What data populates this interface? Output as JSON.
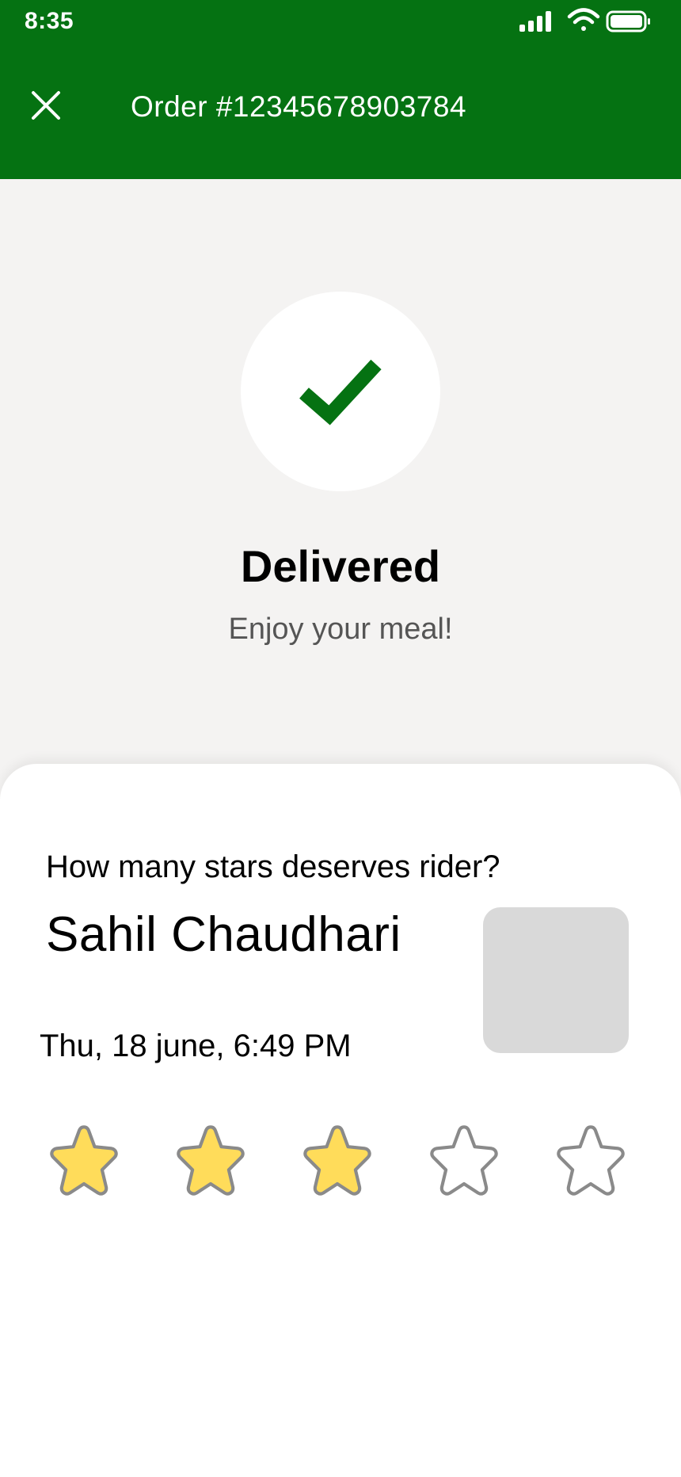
{
  "status_bar": {
    "time": "8:35"
  },
  "header": {
    "title": "Order #12345678903784",
    "close_icon": "close-icon"
  },
  "delivery_status": {
    "icon": "check-icon",
    "title": "Delivered",
    "subtitle": "Enjoy your meal!"
  },
  "rating": {
    "question": "How many stars deserves rider?",
    "rider_name": "Sahil Chaudhari",
    "datetime": "Thu, 18 june, 6:49 PM",
    "stars_total": 5,
    "stars_selected": 3
  },
  "colors": {
    "brand_green": "#057212",
    "star_filled": "#ffdc5a",
    "star_outline": "#8a8a8a"
  }
}
